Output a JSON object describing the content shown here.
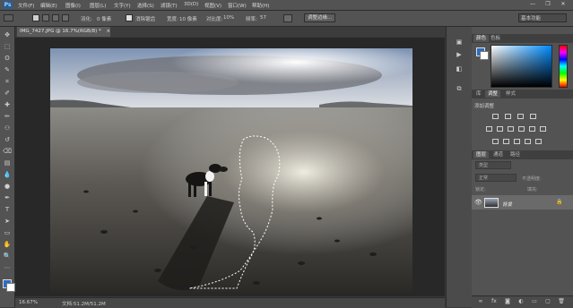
{
  "app": {
    "logo": "Ps"
  },
  "menu": [
    "文件(F)",
    "编辑(E)",
    "图像(I)",
    "图层(L)",
    "文字(Y)",
    "选择(S)",
    "滤镜(T)",
    "3D(D)",
    "视图(V)",
    "窗口(W)",
    "帮助(H)"
  ],
  "window_controls": {
    "minimize": "—",
    "restore": "❐",
    "close": "✕"
  },
  "options": {
    "feather_label": "羽化:",
    "feather_value": "0 像素",
    "antialias_label": "消除锯齿",
    "width_label": "宽度:",
    "width_value": "10 像素",
    "contrast_label": "对比度:",
    "contrast_value": "10%",
    "frequency_label": "频率:",
    "frequency_value": "57",
    "refine_edge": "调整边缘...",
    "workspace": "基本功能"
  },
  "document": {
    "tab_title": "IMG_7427.JPG @ 16.7%(RGB/8) *",
    "tab_close": "×",
    "zoom": "16.67%",
    "doc_info": "文档:51.2M/51.2M"
  },
  "panels": {
    "color_tabs": [
      "颜色",
      "色板"
    ],
    "adjust_tabs": [
      "库",
      "调整",
      "样式"
    ],
    "adjust_add_label": "添加调整",
    "layer_tabs": [
      "图层",
      "通道",
      "路径"
    ],
    "kind_label": "类型",
    "blend_mode": "正常",
    "opacity_label": "不透明度:",
    "lock_label": "锁定:",
    "fill_label": "填充:",
    "layer_name": "背景"
  },
  "colors": {
    "foreground": "#2c6cc4",
    "background": "#ffffff",
    "ui_dark": "#535353"
  },
  "icons": {
    "tools": [
      "move-icon",
      "marquee-icon",
      "lasso-icon",
      "quick-select-icon",
      "crop-icon",
      "eyedropper-icon",
      "healing-brush-icon",
      "brush-icon",
      "clone-stamp-icon",
      "history-brush-icon",
      "eraser-icon",
      "gradient-icon",
      "blur-icon",
      "dodge-icon",
      "pen-icon",
      "type-icon",
      "path-select-icon",
      "shape-icon",
      "hand-icon",
      "zoom-icon",
      "extra-icon"
    ]
  }
}
